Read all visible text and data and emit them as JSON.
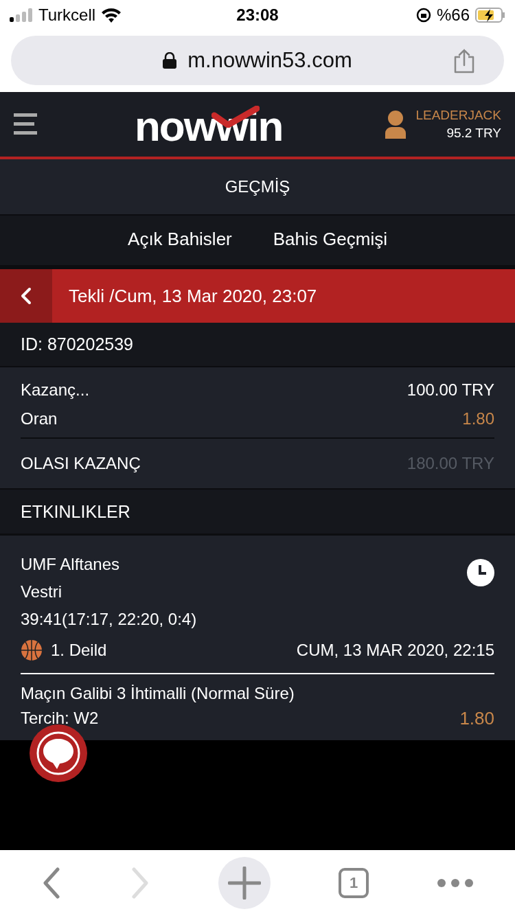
{
  "status_bar": {
    "carrier": "Turkcell",
    "time": "23:08",
    "battery": "%66"
  },
  "url_bar": {
    "url": "m.nowwin53.com"
  },
  "header": {
    "logo": "nowwin",
    "username": "LEADERJACK",
    "balance": "95.2 TRY"
  },
  "page_title": "GEÇMİŞ",
  "tabs": [
    {
      "label": "Açık Bahisler",
      "selected": false
    },
    {
      "label": "Bahis Geçmişi",
      "selected": false
    }
  ],
  "bet": {
    "title": "Tekli /Cum, 13 Mar 2020, 23:07",
    "id": "ID: 870202539",
    "summary": [
      {
        "label": "Kazanç...",
        "value": "100.00 TRY",
        "kind": "amount"
      },
      {
        "label": "Oran",
        "value": "1.80",
        "kind": "odds"
      },
      {
        "label": "OLASI KAZANÇ",
        "value": "180.00 TRY",
        "kind": "potential"
      }
    ],
    "events_heading": "ETKINLIKLER",
    "events": [
      {
        "home": "UMF Alftanes",
        "away": "Vestri",
        "score": "39:41(17:17, 22:20, 0:4)",
        "league": "1. Deild",
        "date": "CUM, 13 MAR 2020, 22:15",
        "market": "Maçın Galibi 3 İhtimalli (Normal Süre)",
        "pick": "Tercih: W2",
        "odds": "1.80"
      }
    ]
  },
  "toolbar": {
    "tab_count": "1"
  }
}
